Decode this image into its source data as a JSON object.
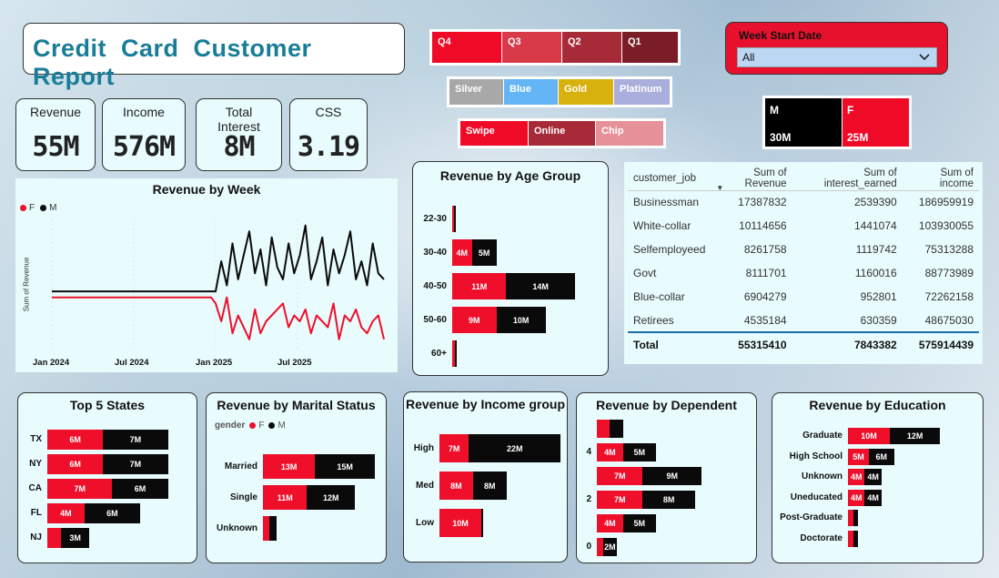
{
  "report": {
    "title": "Credit  Card  Customer  Report"
  },
  "kpis": [
    {
      "label": "Revenue",
      "value": "55M"
    },
    {
      "label": "Income",
      "value": "576M"
    },
    {
      "label": "Total Interest",
      "value": "8M"
    },
    {
      "label": "CSS",
      "value": "3.19"
    }
  ],
  "quarter_slicer": [
    "Q4",
    "Q3",
    "Q2",
    "Q1"
  ],
  "card_category_slicer": [
    "Silver",
    "Blue",
    "Gold",
    "Platinum"
  ],
  "use_chip_slicer": [
    "Swipe",
    "Online",
    "Chip"
  ],
  "week_filter": {
    "label": "Week Start Date",
    "value": "All"
  },
  "gender_cards": [
    {
      "label": "M",
      "value": "30M"
    },
    {
      "label": "F",
      "value": "25M"
    }
  ],
  "colors": {
    "female": "#ef0f2a",
    "male": "#0a0a0a",
    "title": "#1a7d98",
    "accent_red": "#e8112d"
  },
  "week_chart": {
    "title": "Revenue by Week",
    "legend": [
      "F",
      "M"
    ],
    "ylabel": "Sum of Revenue",
    "xticks": [
      "Jan 2024",
      "Jul 2024",
      "Jan 2025",
      "Jul 2025"
    ]
  },
  "age_chart": {
    "title": "Revenue by Age Group"
  },
  "states_chart": {
    "title": "Top 5 States"
  },
  "marital_chart": {
    "title": "Revenue by Marital Status",
    "legend_label": "gender",
    "legend": [
      "F",
      "M"
    ]
  },
  "income_chart": {
    "title": "Revenue by Income group"
  },
  "dependent_chart": {
    "title": "Revenue by Dependent"
  },
  "education_chart": {
    "title": "Revenue by Education"
  },
  "job_table": {
    "headers": [
      "customer_job",
      "Sum of Revenue",
      "Sum of interest_earned",
      "Sum of income"
    ],
    "rows": [
      [
        "Businessman",
        "17387832",
        "2539390",
        "186959919"
      ],
      [
        "White-collar",
        "10114656",
        "1441074",
        "103930055"
      ],
      [
        "Selfemployeed",
        "8261758",
        "1119742",
        "75313288"
      ],
      [
        "Govt",
        "8111701",
        "1160016",
        "88773989"
      ],
      [
        "Blue-collar",
        "6904279",
        "952801",
        "72262158"
      ],
      [
        "Retirees",
        "4535184",
        "630359",
        "48675030"
      ]
    ],
    "total": [
      "Total",
      "55315410",
      "7843382",
      "575914439"
    ]
  },
  "chart_data": [
    {
      "type": "line",
      "title": "Revenue by Week",
      "ylabel": "Sum of Revenue",
      "series": [
        {
          "name": "F",
          "values": [
            0.9,
            0.9,
            0.9,
            0.9,
            0.9,
            0.9,
            0.9,
            0.9,
            0.9,
            0.9,
            0.9,
            0.9,
            0.8,
            0.5,
            0.9,
            0.3,
            0.6,
            0.4,
            0.2,
            0.7,
            0.3,
            0.5,
            0.6,
            0.7,
            0.8,
            0.4,
            0.6,
            0.5,
            0.7,
            0.3,
            0.6,
            0.5,
            0.4,
            0.8,
            0.2,
            0.6,
            0.5,
            0.7,
            0.4,
            0.3,
            0.5,
            0.6,
            0.2
          ]
        },
        {
          "name": "M",
          "values": [
            1.0,
            1.0,
            1.0,
            1.0,
            1.0,
            1.0,
            1.0,
            1.0,
            1.0,
            1.0,
            1.0,
            1.0,
            1.0,
            1.5,
            1.1,
            1.8,
            1.2,
            1.6,
            2.0,
            1.3,
            1.7,
            1.1,
            1.9,
            1.4,
            1.2,
            1.8,
            1.3,
            1.6,
            2.1,
            1.2,
            1.5,
            1.9,
            1.1,
            1.7,
            1.3,
            1.6,
            2.0,
            1.2,
            1.5,
            1.1,
            1.8,
            1.3,
            1.2
          ]
        }
      ]
    },
    {
      "type": "bar",
      "title": "Revenue by Age Group",
      "categories": [
        "22-30",
        "30-40",
        "40-50",
        "50-60",
        "60+"
      ],
      "series": [
        {
          "name": "F",
          "values": [
            0.4,
            4,
            11,
            9,
            0.6
          ]
        },
        {
          "name": "M",
          "values": [
            0.3,
            5,
            14,
            10,
            0.4
          ]
        }
      ],
      "labels": {
        "F": [
          "",
          "4M",
          "11M",
          "9M",
          ""
        ],
        "M": [
          "",
          "5M",
          "14M",
          "10M",
          ""
        ]
      }
    },
    {
      "type": "bar",
      "title": "Top 5 States",
      "categories": [
        "TX",
        "NY",
        "CA",
        "FL",
        "NJ"
      ],
      "series": [
        {
          "name": "F",
          "values": [
            6,
            6,
            7,
            4,
            1.5
          ]
        },
        {
          "name": "M",
          "values": [
            7,
            7,
            6,
            6,
            3
          ]
        }
      ],
      "labels": {
        "F": [
          "6M",
          "6M",
          "7M",
          "4M",
          ""
        ],
        "M": [
          "7M",
          "7M",
          "6M",
          "6M",
          "3M"
        ]
      }
    },
    {
      "type": "bar",
      "title": "Revenue by Marital Status",
      "categories": [
        "Married",
        "Single",
        "Unknown"
      ],
      "series": [
        {
          "name": "F",
          "values": [
            13,
            11,
            1.5
          ]
        },
        {
          "name": "M",
          "values": [
            15,
            12,
            2
          ]
        }
      ],
      "labels": {
        "F": [
          "13M",
          "11M",
          ""
        ],
        "M": [
          "15M",
          "12M",
          ""
        ]
      }
    },
    {
      "type": "bar",
      "title": "Revenue by Income group",
      "categories": [
        "High",
        "Med",
        "Low"
      ],
      "series": [
        {
          "name": "F",
          "values": [
            7,
            8,
            10
          ]
        },
        {
          "name": "M",
          "values": [
            22,
            8,
            0.5
          ]
        }
      ],
      "labels": {
        "F": [
          "7M",
          "8M",
          "10M"
        ],
        "M": [
          "22M",
          "8M",
          ""
        ]
      }
    },
    {
      "type": "bar",
      "title": "Revenue by Dependent",
      "categories": [
        "",
        "4",
        "",
        "2",
        "",
        "0"
      ],
      "series": [
        {
          "name": "F",
          "values": [
            2,
            4,
            7,
            7,
            4,
            1
          ]
        },
        {
          "name": "M",
          "values": [
            2,
            5,
            9,
            8,
            5,
            2
          ]
        }
      ],
      "labels": {
        "F": [
          "",
          "4M",
          "7M",
          "7M",
          "4M",
          ""
        ],
        "M": [
          "",
          "5M",
          "9M",
          "8M",
          "5M",
          "2M"
        ]
      }
    },
    {
      "type": "bar",
      "title": "Revenue by Education",
      "categories": [
        "Graduate",
        "High School",
        "Unknown",
        "Uneducated",
        "Post-Graduate",
        "Doctorate"
      ],
      "series": [
        {
          "name": "F",
          "values": [
            10,
            5,
            4,
            4,
            1.3,
            1.3
          ]
        },
        {
          "name": "M",
          "values": [
            12,
            6,
            4,
            4,
            1,
            1
          ]
        }
      ],
      "labels": {
        "F": [
          "10M",
          "5M",
          "4M",
          "4M",
          "",
          ""
        ],
        "M": [
          "12M",
          "6M",
          "4M",
          "4M",
          "",
          ""
        ]
      }
    }
  ]
}
